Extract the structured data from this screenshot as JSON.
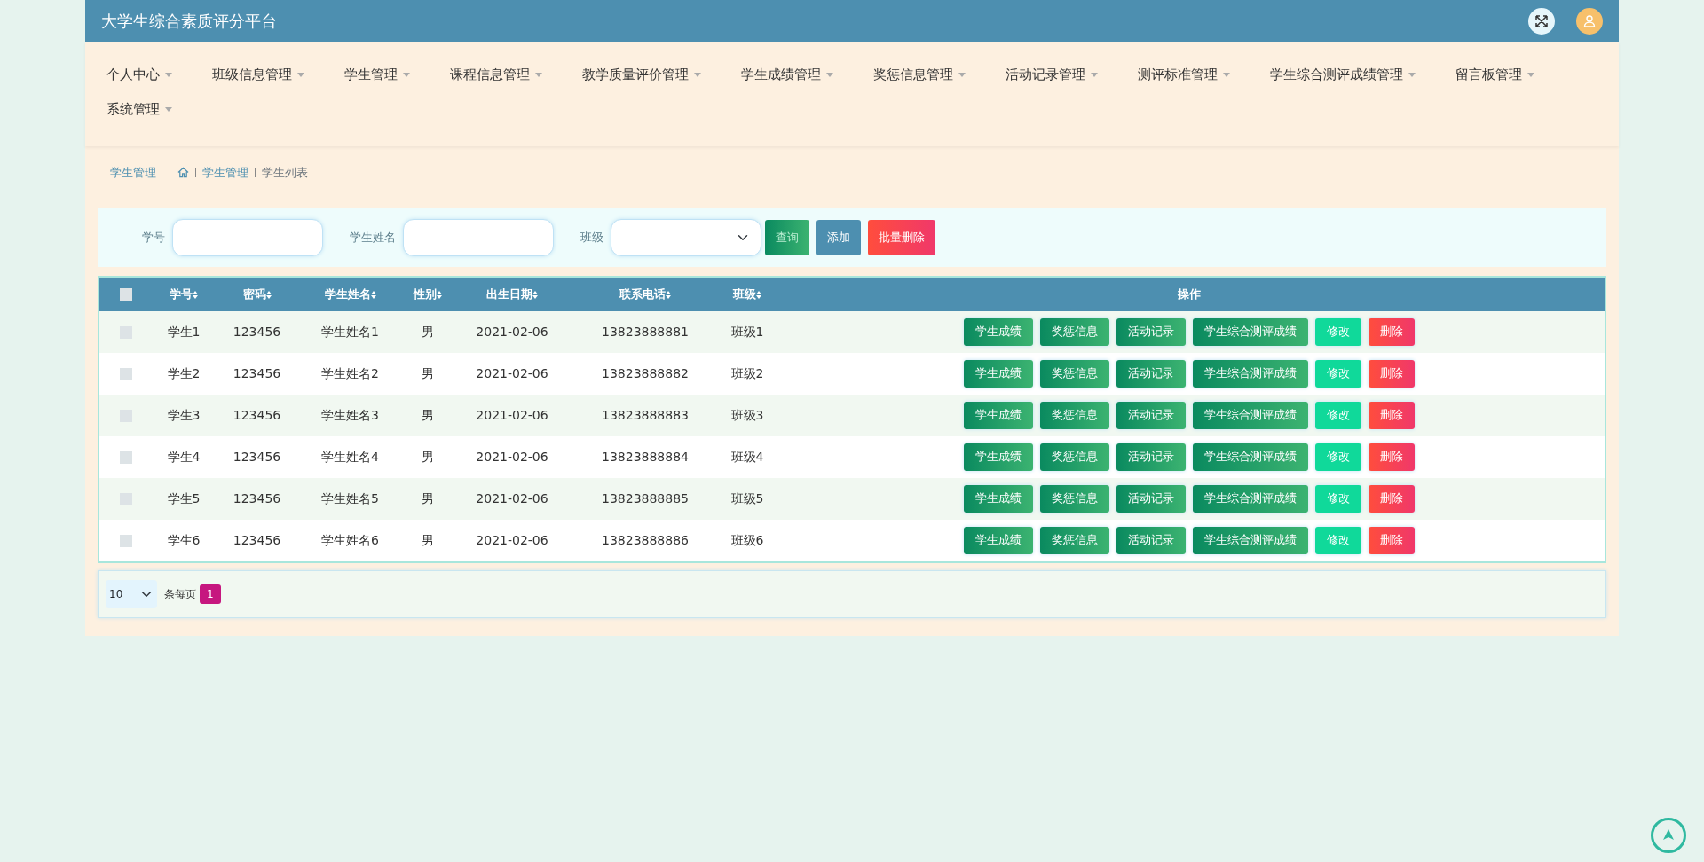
{
  "header": {
    "title": "大学生综合素质评分平台"
  },
  "nav": {
    "items": [
      {
        "label": "个人中心"
      },
      {
        "label": "班级信息管理"
      },
      {
        "label": "学生管理"
      },
      {
        "label": "课程信息管理"
      },
      {
        "label": "教学质量评价管理"
      },
      {
        "label": "学生成绩管理"
      },
      {
        "label": "奖惩信息管理"
      },
      {
        "label": "活动记录管理"
      },
      {
        "label": "测评标准管理"
      },
      {
        "label": "学生综合测评成绩管理"
      },
      {
        "label": "留言板管理"
      },
      {
        "label": "系统管理"
      }
    ]
  },
  "breadcrumb": {
    "title": "学生管理",
    "items": [
      "学生管理",
      "学生列表"
    ]
  },
  "search": {
    "fields": [
      {
        "label": "学号",
        "kind": "input"
      },
      {
        "label": "学生姓名",
        "kind": "input"
      },
      {
        "label": "班级",
        "kind": "select"
      }
    ],
    "buttons": [
      {
        "label": "查询",
        "kind": "query"
      },
      {
        "label": "添加",
        "kind": "add"
      },
      {
        "label": "批量删除",
        "kind": "delete"
      }
    ]
  },
  "table": {
    "select_all": {
      "checked": false
    },
    "columns": [
      "学号",
      "密码",
      "学生姓名",
      "性别",
      "出生日期",
      "联系电话",
      "班级"
    ],
    "actions_header": "操作",
    "rows": [
      {
        "checked": false,
        "cells": [
          "学生1",
          "123456",
          "学生姓名1",
          "男",
          "2021-02-06",
          "13823888881",
          "班级1"
        ],
        "actions": [
          {
            "label": "学生成绩",
            "kind": "green"
          },
          {
            "label": "奖惩信息",
            "kind": "green"
          },
          {
            "label": "活动记录",
            "kind": "green"
          },
          {
            "label": "学生综合测评成绩",
            "kind": "green"
          },
          {
            "label": "修改",
            "kind": "edit"
          },
          {
            "label": "删除",
            "kind": "delete"
          }
        ]
      },
      {
        "checked": false,
        "cells": [
          "学生2",
          "123456",
          "学生姓名2",
          "男",
          "2021-02-06",
          "13823888882",
          "班级2"
        ],
        "actions": [
          {
            "label": "学生成绩",
            "kind": "green"
          },
          {
            "label": "奖惩信息",
            "kind": "green"
          },
          {
            "label": "活动记录",
            "kind": "green"
          },
          {
            "label": "学生综合测评成绩",
            "kind": "green"
          },
          {
            "label": "修改",
            "kind": "edit"
          },
          {
            "label": "删除",
            "kind": "delete"
          }
        ]
      },
      {
        "checked": false,
        "cells": [
          "学生3",
          "123456",
          "学生姓名3",
          "男",
          "2021-02-06",
          "13823888883",
          "班级3"
        ],
        "actions": [
          {
            "label": "学生成绩",
            "kind": "green"
          },
          {
            "label": "奖惩信息",
            "kind": "green"
          },
          {
            "label": "活动记录",
            "kind": "green"
          },
          {
            "label": "学生综合测评成绩",
            "kind": "green"
          },
          {
            "label": "修改",
            "kind": "edit"
          },
          {
            "label": "删除",
            "kind": "delete"
          }
        ]
      },
      {
        "checked": false,
        "cells": [
          "学生4",
          "123456",
          "学生姓名4",
          "男",
          "2021-02-06",
          "13823888884",
          "班级4"
        ],
        "actions": [
          {
            "label": "学生成绩",
            "kind": "green"
          },
          {
            "label": "奖惩信息",
            "kind": "green"
          },
          {
            "label": "活动记录",
            "kind": "green"
          },
          {
            "label": "学生综合测评成绩",
            "kind": "green"
          },
          {
            "label": "修改",
            "kind": "edit"
          },
          {
            "label": "删除",
            "kind": "delete"
          }
        ]
      },
      {
        "checked": false,
        "cells": [
          "学生5",
          "123456",
          "学生姓名5",
          "男",
          "2021-02-06",
          "13823888885",
          "班级5"
        ],
        "actions": [
          {
            "label": "学生成绩",
            "kind": "green"
          },
          {
            "label": "奖惩信息",
            "kind": "green"
          },
          {
            "label": "活动记录",
            "kind": "green"
          },
          {
            "label": "学生综合测评成绩",
            "kind": "green"
          },
          {
            "label": "修改",
            "kind": "edit"
          },
          {
            "label": "删除",
            "kind": "delete"
          }
        ]
      },
      {
        "checked": false,
        "cells": [
          "学生6",
          "123456",
          "学生姓名6",
          "男",
          "2021-02-06",
          "13823888886",
          "班级6"
        ],
        "actions": [
          {
            "label": "学生成绩",
            "kind": "green"
          },
          {
            "label": "奖惩信息",
            "kind": "green"
          },
          {
            "label": "活动记录",
            "kind": "green"
          },
          {
            "label": "学生综合测评成绩",
            "kind": "green"
          },
          {
            "label": "修改",
            "kind": "edit"
          },
          {
            "label": "删除",
            "kind": "delete"
          }
        ]
      }
    ]
  },
  "pagination": {
    "page_size": "10",
    "suffix": "条每页",
    "pages": [
      {
        "label": "1",
        "selected": true
      }
    ]
  }
}
